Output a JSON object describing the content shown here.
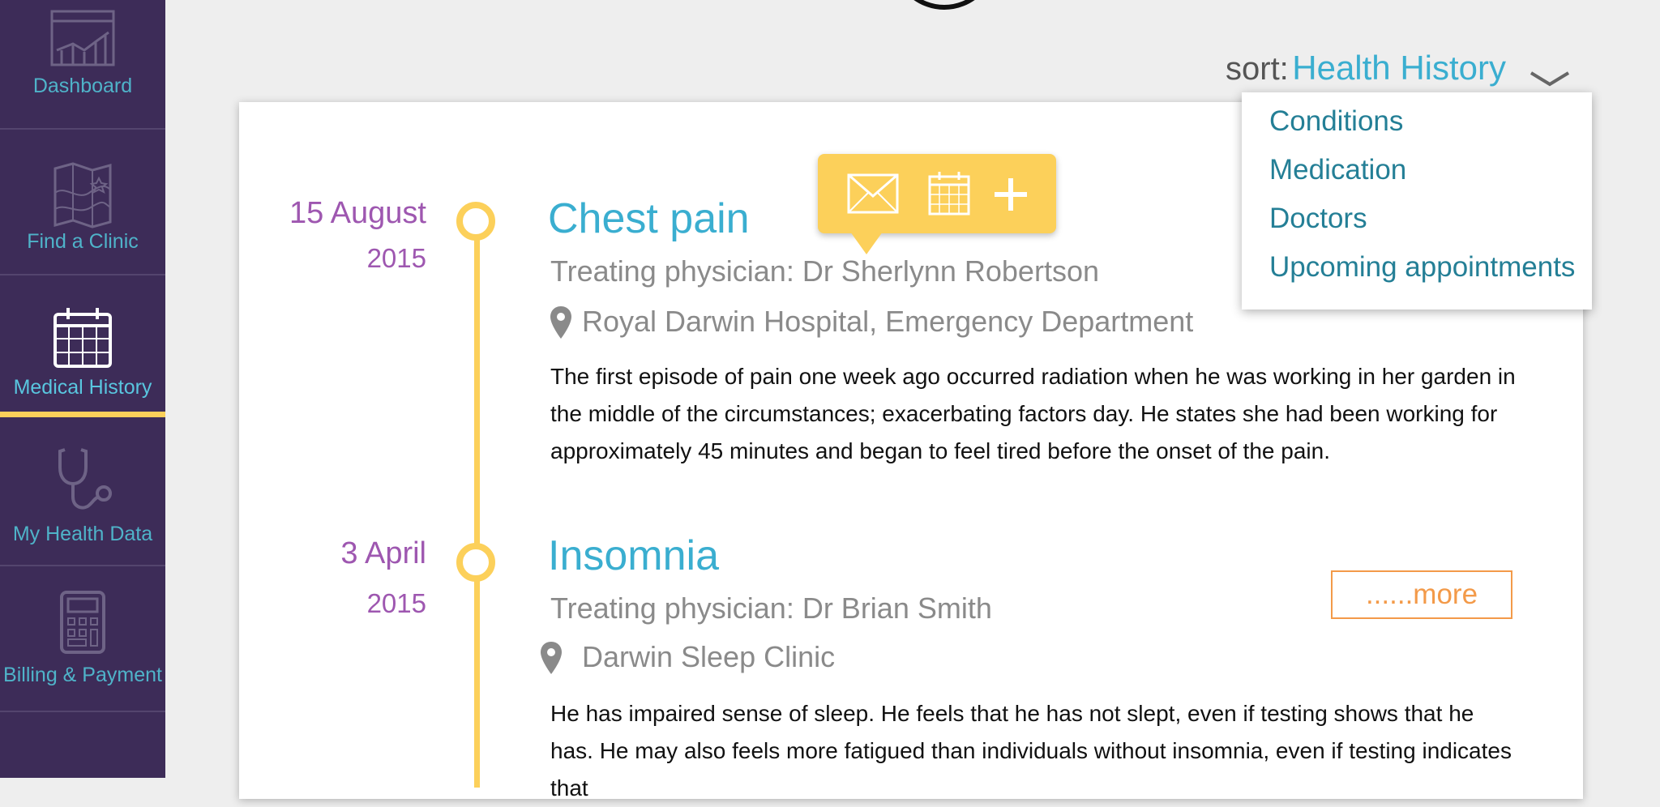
{
  "sidebar": {
    "items": [
      {
        "label": "Dashboard",
        "icon": "dashboard-chart-icon"
      },
      {
        "label": "Find a Clinic",
        "icon": "map-icon"
      },
      {
        "label": "Medical History",
        "icon": "calendar-icon",
        "active": true
      },
      {
        "label": "My Health Data",
        "icon": "stethoscope-icon"
      },
      {
        "label": "Billing & Payment",
        "icon": "calculator-icon"
      }
    ]
  },
  "sort": {
    "prefix": "sort:",
    "value": "Health History",
    "options": [
      "Conditions",
      "Medication",
      "Doctors",
      "Upcoming appointments"
    ]
  },
  "popup": {
    "actions": [
      "email-icon",
      "calendar-icon",
      "plus-icon"
    ]
  },
  "timeline": [
    {
      "day": "15 August",
      "year": "2015",
      "title": "Chest pain",
      "physician": "Treating physician: Dr Sherlynn Robertson",
      "location": "Royal Darwin Hospital, Emergency Department",
      "description": "The first episode of pain one week ago occurred radiation when he was working in her garden in the middle of the circumstances; exacerbating factors day. He states she had been working for approximately 45 minutes and began to feel tired before the onset of the pain."
    },
    {
      "day": "3 April",
      "year": "2015",
      "title": "Insomnia",
      "physician": "Treating physician: Dr Brian Smith",
      "location": "Darwin Sleep Clinic",
      "description": "He has impaired sense of sleep. He feels that he has not slept, even if testing shows that he has. He may also feels more fatigued than individuals without insomnia, even if testing indicates that",
      "more_label": "......more"
    }
  ],
  "colors": {
    "sidebar_bg": "#3d2c58",
    "accent_blue": "#3aaed0",
    "timeline_yellow": "#fcd05a",
    "date_purple": "#9e57b0",
    "more_orange": "#f39a49"
  }
}
